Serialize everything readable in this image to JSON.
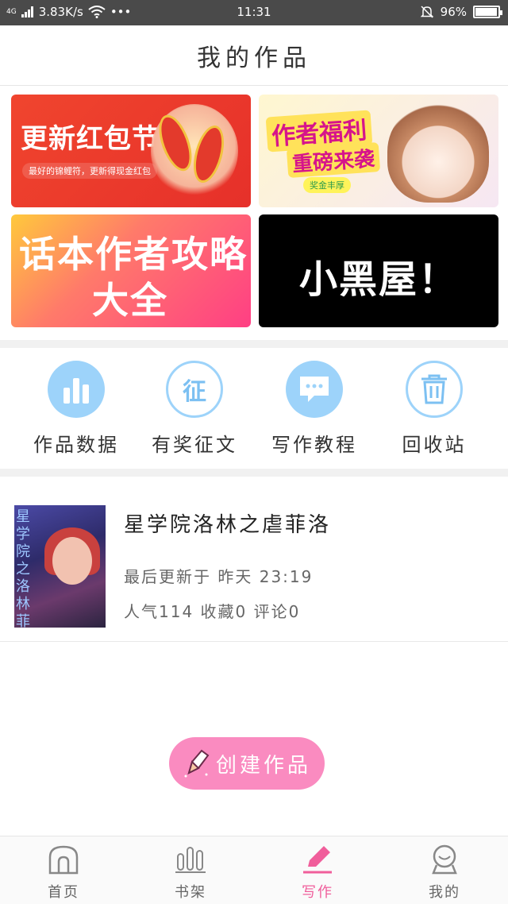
{
  "status_bar": {
    "network": "4G",
    "speed": "3.83K/s",
    "more": "•••",
    "time": "11:31",
    "battery": "96%",
    "battery_level": 0.96
  },
  "header": {
    "title": "我的作品"
  },
  "banners": [
    {
      "title": "更新红包节",
      "subtitle": "最好的锦鲤符，更新得现金红包"
    },
    {
      "line1": "作者福利",
      "line2": "重磅来袭",
      "badge": "奖金丰厚"
    },
    {
      "line1": "话本作者攻略",
      "line2": "大全"
    },
    {
      "title": "小黑屋！"
    }
  ],
  "actions": [
    {
      "label": "作品数据",
      "icon": "bar-chart-icon"
    },
    {
      "label": "有奖征文",
      "icon": "contest-icon",
      "glyph": "征"
    },
    {
      "label": "写作教程",
      "icon": "chat-bubble-icon"
    },
    {
      "label": "回收站",
      "icon": "trash-icon"
    }
  ],
  "work": {
    "title": "星学院洛林之虐菲洛",
    "updated": "最后更新于 昨天 23:19",
    "stats": "人气114 收藏0 评论0"
  },
  "create_button": {
    "label": "创建作品"
  },
  "bottom_nav": [
    {
      "label": "首页",
      "icon": "home-icon"
    },
    {
      "label": "书架",
      "icon": "bookshelf-icon"
    },
    {
      "label": "写作",
      "icon": "pencil-icon",
      "active": true
    },
    {
      "label": "我的",
      "icon": "profile-icon"
    }
  ],
  "colors": {
    "accent": "#f05e9b",
    "action_blue": "#9dd3fa",
    "create_button": "#fa8bc0"
  }
}
